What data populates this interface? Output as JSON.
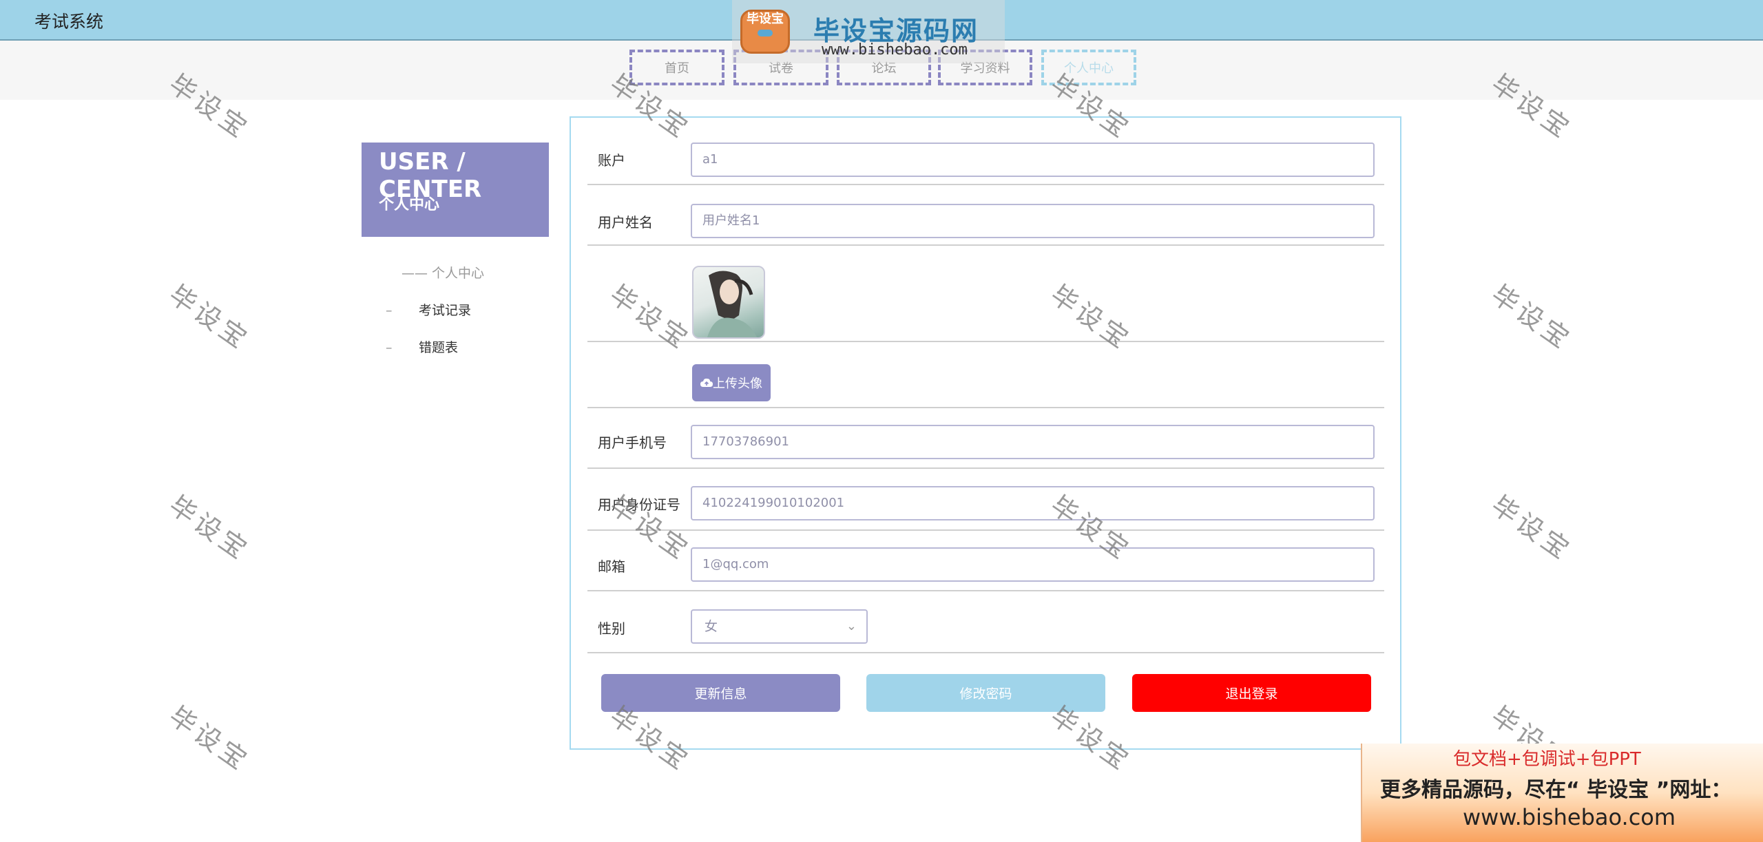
{
  "app": {
    "title": "考试系统"
  },
  "nav": {
    "items": [
      "首页",
      "试卷",
      "论坛",
      "学习资料",
      "个人中心"
    ],
    "active_index": 4
  },
  "logo_watermark": {
    "badge": "毕设宝",
    "text": "毕设宝源码网",
    "url": "www.bishebao.com"
  },
  "sidebar": {
    "heading_en": "USER / CENTER",
    "heading_cn": "个人中心",
    "items": [
      {
        "label": "个人中心",
        "prefix": "——"
      },
      {
        "label": "考试记录",
        "prefix": "–"
      },
      {
        "label": "错题表",
        "prefix": "–"
      }
    ]
  },
  "form": {
    "account": {
      "label": "账户",
      "value": "a1"
    },
    "name": {
      "label": "用户姓名",
      "value": "用户姓名1"
    },
    "avatar": {
      "upload_label": "上传头像"
    },
    "phone": {
      "label": "用户手机号",
      "value": "17703786901"
    },
    "id_card": {
      "label": "用户身份证号",
      "value": "410224199010102001"
    },
    "email": {
      "label": "邮箱",
      "value": "1@qq.com"
    },
    "gender": {
      "label": "性别",
      "value": "女"
    }
  },
  "buttons": {
    "update": "更新信息",
    "change_password": "修改密码",
    "logout": "退出登录"
  },
  "watermark": {
    "text": "毕设宝"
  },
  "promo": {
    "line1": "包文档+包调试+包PPT",
    "line2": "更多精品源码，尽在“ 毕设宝 ”网址：",
    "line3": "www.bishebao.com"
  },
  "colors": {
    "topbar": "#9ed3e8",
    "accent": "#8b8bc4",
    "secondary": "#a0d4ea",
    "danger": "#ff0000"
  },
  "icons": {
    "upload": "cloud-upload-icon",
    "dropdown": "chevron-down-icon"
  }
}
